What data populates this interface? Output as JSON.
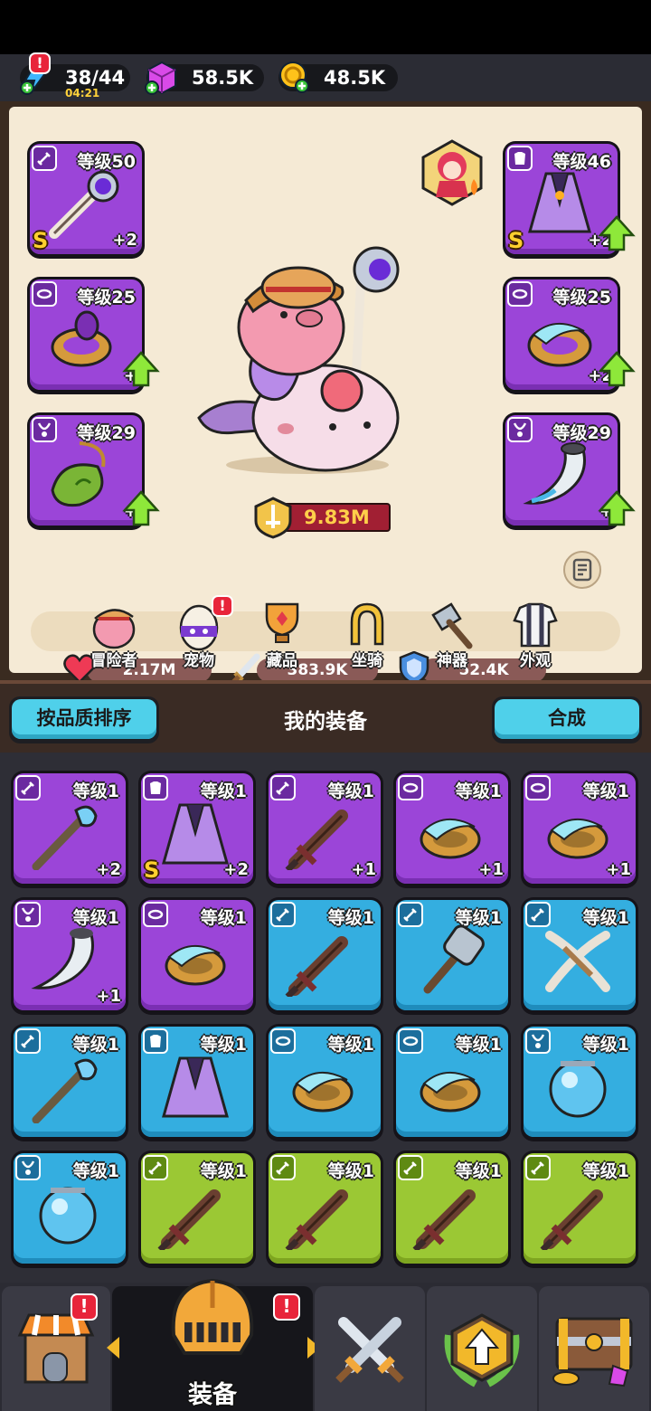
{
  "topbar": {
    "energy": "38/44",
    "energy_timer": "04:21",
    "energy_alert": "!",
    "gems": "58.5K",
    "coins": "48.5K"
  },
  "equipped": {
    "weapon": {
      "level": "等级50",
      "plus": "+2",
      "rank": "S"
    },
    "armor": {
      "level": "等级46",
      "plus": "+2",
      "rank": "S"
    },
    "ring_left": {
      "level": "等级25",
      "plus": "+"
    },
    "ring_right": {
      "level": "等级25",
      "plus": "+2"
    },
    "necklace_left": {
      "level": "等级29",
      "plus": "+"
    },
    "necklace_right": {
      "level": "等级29",
      "plus": "+"
    }
  },
  "power": "9.83M",
  "stats": {
    "hp": "2.17M",
    "attack": "383.9K",
    "defense": "52.4K"
  },
  "nav_tabs": [
    "冒险者",
    "宠物",
    "藏品",
    "坐骑",
    "神器",
    "外观"
  ],
  "pet_alert": "!",
  "equipment_section": {
    "sort_button": "按品质排序",
    "title": "我的装备",
    "merge_button": "合成"
  },
  "inventory": [
    {
      "type": "staff",
      "quality": "purple",
      "level": "等级1",
      "plus": "+2",
      "rank": ""
    },
    {
      "type": "armor",
      "quality": "purple",
      "level": "等级1",
      "plus": "+2",
      "rank": "S"
    },
    {
      "type": "sword",
      "quality": "purple",
      "level": "等级1",
      "plus": "+1",
      "rank": ""
    },
    {
      "type": "ring",
      "quality": "purple",
      "level": "等级1",
      "plus": "+1",
      "rank": ""
    },
    {
      "type": "ring",
      "quality": "purple",
      "level": "等级1",
      "plus": "+1",
      "rank": ""
    },
    {
      "type": "horn",
      "quality": "purple",
      "level": "等级1",
      "plus": "+1",
      "rank": ""
    },
    {
      "type": "ring",
      "quality": "purple",
      "level": "等级1",
      "plus": "",
      "rank": ""
    },
    {
      "type": "sword",
      "quality": "blue",
      "level": "等级1",
      "plus": "",
      "rank": ""
    },
    {
      "type": "hammer",
      "quality": "blue",
      "level": "等级1",
      "plus": "",
      "rank": ""
    },
    {
      "type": "bow",
      "quality": "blue",
      "level": "等级1",
      "plus": "",
      "rank": ""
    },
    {
      "type": "staff",
      "quality": "blue",
      "level": "等级1",
      "plus": "",
      "rank": ""
    },
    {
      "type": "armor",
      "quality": "blue",
      "level": "等级1",
      "plus": "",
      "rank": ""
    },
    {
      "type": "ring",
      "quality": "blue",
      "level": "等级1",
      "plus": "",
      "rank": ""
    },
    {
      "type": "ring",
      "quality": "blue",
      "level": "等级1",
      "plus": "",
      "rank": ""
    },
    {
      "type": "orb",
      "quality": "blue",
      "level": "等级1",
      "plus": "",
      "rank": ""
    },
    {
      "type": "orb",
      "quality": "blue",
      "level": "等级1",
      "plus": "",
      "rank": ""
    },
    {
      "type": "sword",
      "quality": "green",
      "level": "等级1",
      "plus": "",
      "rank": ""
    },
    {
      "type": "sword",
      "quality": "green",
      "level": "等级1",
      "plus": "",
      "rank": ""
    },
    {
      "type": "sword",
      "quality": "green",
      "level": "等级1",
      "plus": "",
      "rank": ""
    },
    {
      "type": "sword",
      "quality": "green",
      "level": "等级1",
      "plus": "",
      "rank": ""
    }
  ],
  "bottom_nav": {
    "active_label": "装备",
    "shop_alert": "!",
    "equip_alert": "!"
  },
  "colors": {
    "purple_quality": "#9b45d8",
    "blue_quality": "#34aee0",
    "green_quality": "#9bc834",
    "alert_red": "#e8243a",
    "accent_cyan": "#4fd0ea"
  }
}
